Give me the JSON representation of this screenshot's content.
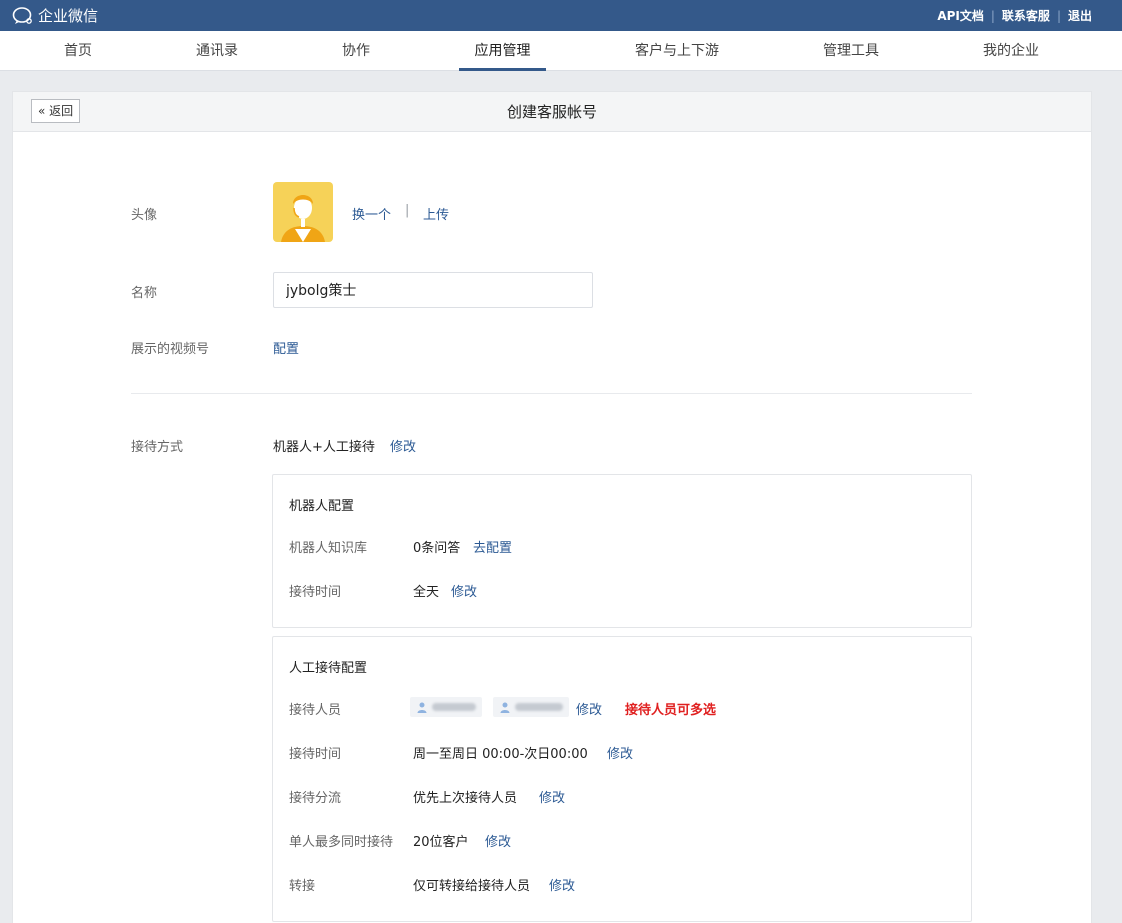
{
  "topbar": {
    "brand": "企业微信",
    "links": [
      "API文档",
      "联系客服",
      "退出"
    ]
  },
  "nav": {
    "items": [
      "首页",
      "通讯录",
      "协作",
      "应用管理",
      "客户与上下游",
      "管理工具",
      "我的企业"
    ],
    "active_index": 3
  },
  "panel": {
    "back_label": "返回",
    "title": "创建客服帐号"
  },
  "form": {
    "avatar_label": "头像",
    "avatar_change": "换一个",
    "avatar_sep": "|",
    "avatar_upload": "上传",
    "name_label": "名称",
    "name_value": "jybolg策士",
    "video_label": "展示的视频号",
    "video_action": "配置",
    "mode_label": "接待方式",
    "mode_value": "机器人+人工接待",
    "mode_edit": "修改"
  },
  "robot_card": {
    "title": "机器人配置",
    "kb_label": "机器人知识库",
    "kb_value": "0条问答",
    "kb_action": "去配置",
    "time_label": "接待时间",
    "time_value": "全天",
    "time_edit": "修改"
  },
  "human_card": {
    "title": "人工接待配置",
    "staff_label": "接待人员",
    "staff_edit": "修改",
    "staff_note": "接待人员可多选",
    "time_label": "接待时间",
    "time_value": "周一至周日 00:00-次日00:00",
    "time_edit": "修改",
    "route_label": "接待分流",
    "route_value": "优先上次接待人员",
    "route_edit": "修改",
    "max_label": "单人最多同时接待",
    "max_value": "20位客户",
    "max_edit": "修改",
    "transfer_label": "转接",
    "transfer_value": "仅可转接给接待人员",
    "transfer_edit": "修改"
  },
  "colors": {
    "topbar": "#34598a",
    "link": "#2c5a94",
    "warning": "#e02020",
    "avatar_bg": "#f6d258"
  }
}
